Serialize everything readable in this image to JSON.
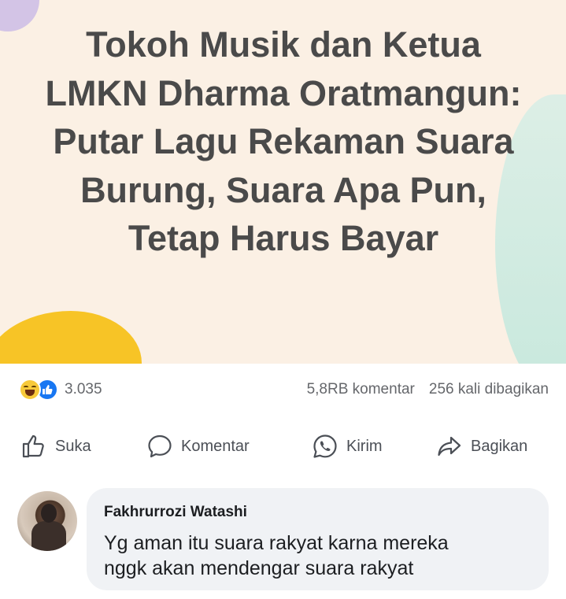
{
  "post": {
    "headline": "Tokoh Musik dan Ketua LMKN Dharma Oratmangun: Putar Lagu Rekaman Suara Burung, Suara Apa Pun, Tetap Harus Bayar"
  },
  "stats": {
    "reaction_icons": [
      "haha-icon",
      "like-icon"
    ],
    "reaction_count": "3.035",
    "comments": "5,8RB komentar",
    "shares": "256 kali dibagikan"
  },
  "actions": {
    "like": "Suka",
    "comment": "Komentar",
    "send": "Kirim",
    "share": "Bagikan"
  },
  "comment": {
    "author": "Fakhrurrozi Watashi",
    "text": "Yg aman itu suara rakyat karna mereka\nnggk akan mendengar  suara rakyat"
  },
  "colors": {
    "image_bg": "#fbf0e4",
    "headline": "#4a4a4a",
    "like_blue": "#1877f2",
    "haha_yellow": "#f7c93a",
    "bubble_bg": "#f0f2f5"
  }
}
